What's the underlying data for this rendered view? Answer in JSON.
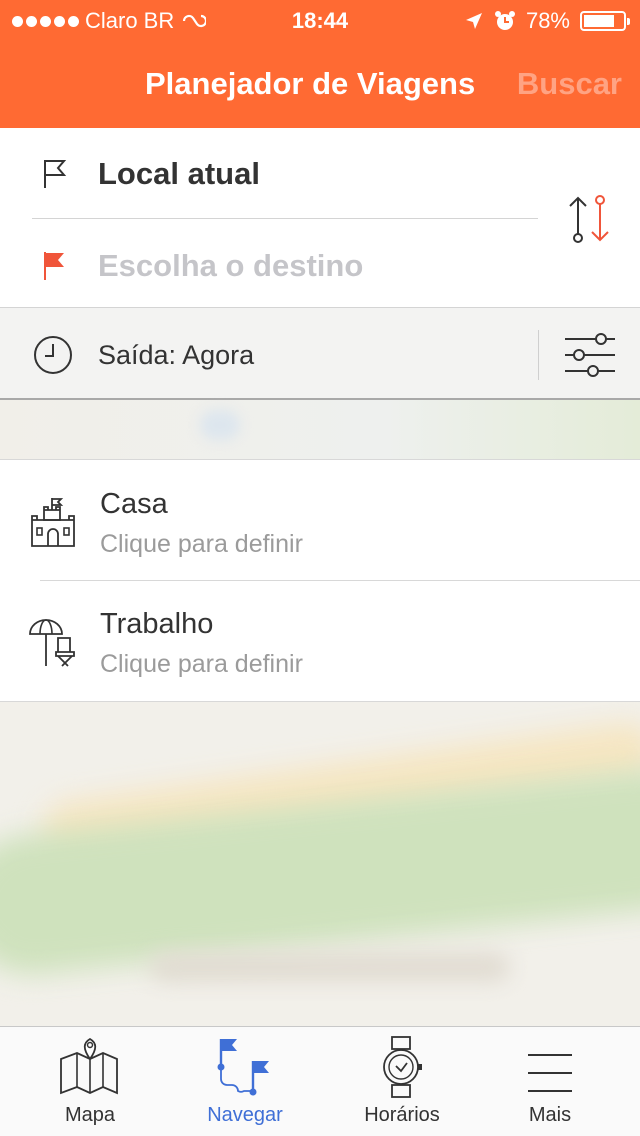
{
  "status_bar": {
    "carrier": "Claro BR",
    "time": "18:44",
    "battery": "78%",
    "battery_level": 0.78
  },
  "header": {
    "title": "Planejador de Viagens",
    "search_label": "Buscar"
  },
  "route": {
    "origin": "Local atual",
    "destination_placeholder": "Escolha o destino"
  },
  "departure": {
    "label": "Saída: Agora"
  },
  "places": [
    {
      "name": "Casa",
      "subtitle": "Clique para definir",
      "icon": "castle-icon"
    },
    {
      "name": "Trabalho",
      "subtitle": "Clique para definir",
      "icon": "beach-chair-icon"
    }
  ],
  "tabs": [
    {
      "label": "Mapa",
      "icon": "map-icon",
      "active": false
    },
    {
      "label": "Navegar",
      "icon": "navigate-flags-icon",
      "active": true
    },
    {
      "label": "Horários",
      "icon": "watch-icon",
      "active": false
    },
    {
      "label": "Mais",
      "icon": "menu-icon",
      "active": false
    }
  ],
  "colors": {
    "accent": "#ff6a33",
    "active_tab": "#3f6fd6"
  }
}
